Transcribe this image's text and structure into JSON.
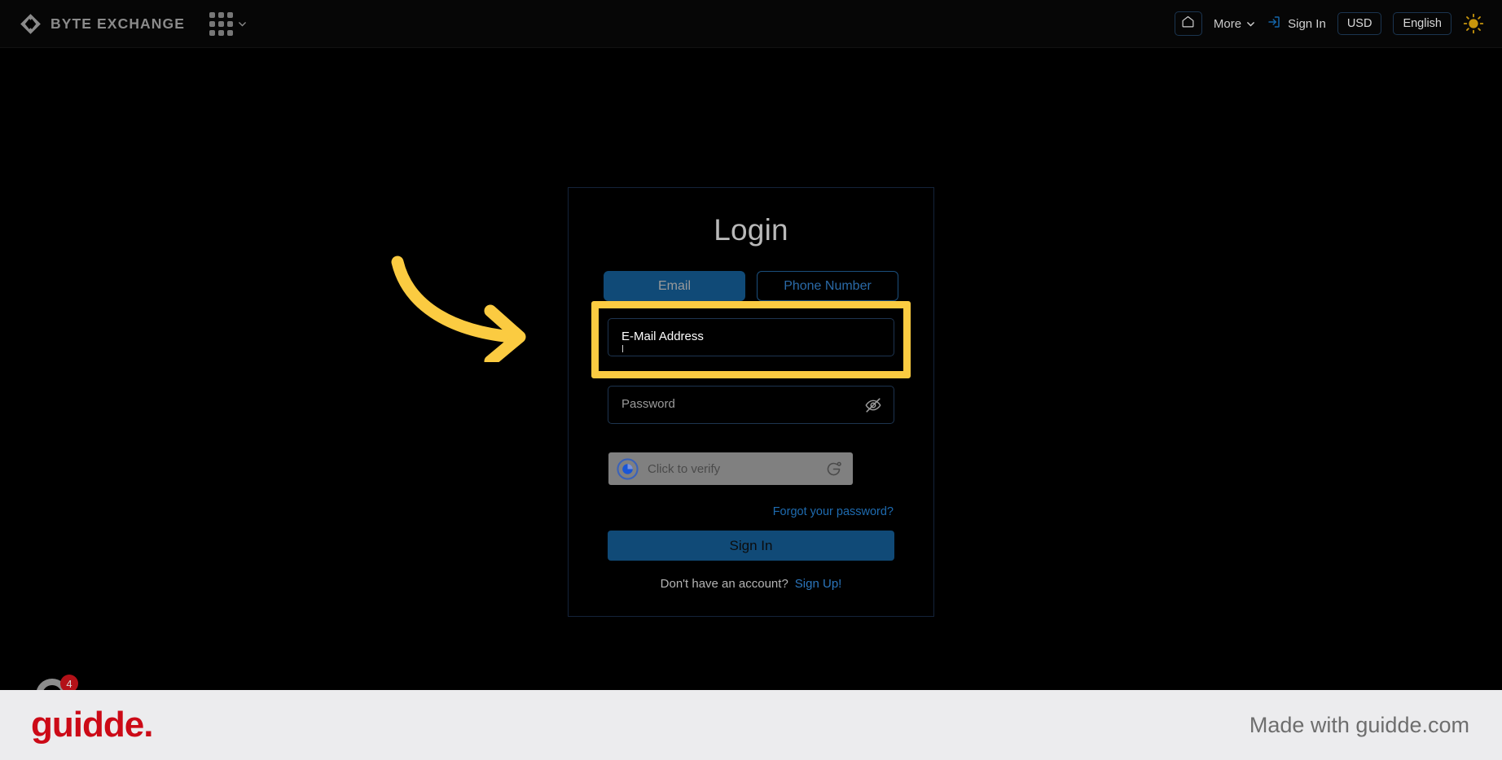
{
  "header": {
    "brand_name": "BYTE EXCHANGE",
    "logo_icon": "diamond-code-logo",
    "apps_grid_icon": "apps-grid-icon",
    "chevron_icon": "chevron-down-icon",
    "nav": {
      "home_icon": "home-icon",
      "more_label": "More",
      "more_chevron_icon": "chevron-down-icon",
      "signin_icon": "sign-in-icon",
      "signin_label": "Sign In",
      "currency_label": "USD",
      "language_label": "English",
      "theme_icon": "sun-icon"
    }
  },
  "login": {
    "title": "Login",
    "tabs": [
      {
        "label": "Email",
        "active": true
      },
      {
        "label": "Phone Number",
        "active": false
      }
    ],
    "email_field": {
      "label": "E-Mail Address",
      "value": "",
      "placeholder": "E-Mail Address"
    },
    "password_field": {
      "label": "Password",
      "value": "",
      "placeholder": "Password",
      "toggle_icon": "eye-off-icon"
    },
    "captcha": {
      "text": "Click to verify",
      "orb_icon": "captcha-orb-icon",
      "refresh_icon": "refresh-icon"
    },
    "forgot_password": "Forgot your password?",
    "submit_label": "Sign In",
    "signup_prompt": "Don't have an account?",
    "signup_link": "Sign Up!"
  },
  "annotations": {
    "arrow_icon": "curved-arrow-icon",
    "highlight_color": "#FBCB41"
  },
  "chat_widget": {
    "icon": "chat-bubble-icon",
    "badge_count": "4"
  },
  "footer": {
    "logo_text": "guidde.",
    "made_with": "Made with guidde.com"
  },
  "colors": {
    "page_background": "#000000",
    "accent_blue": "#104a77",
    "link_blue": "#2b76bd",
    "highlight_yellow": "#FBCB41",
    "guidde_red": "#cc0a17",
    "footer_background": "#ececee",
    "sun_gold": "#C8960C"
  }
}
